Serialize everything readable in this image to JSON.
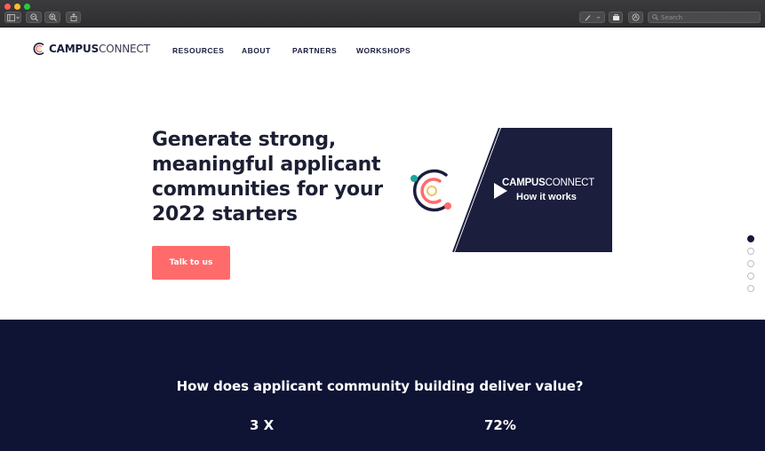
{
  "window": {
    "search_placeholder": "Search",
    "icons": [
      "sidebar-icon",
      "zoom-out-icon",
      "zoom-in-icon",
      "share-icon",
      "pen-icon",
      "markup-icon",
      "annotate-icon",
      "search-icon"
    ]
  },
  "logo": {
    "bold": "CAMPUS",
    "light": "CONNECT"
  },
  "nav": [
    {
      "label": "RESOURCES"
    },
    {
      "label": "ABOUT"
    },
    {
      "label": "PARTNERS"
    },
    {
      "label": "WORKSHOPS"
    }
  ],
  "hero": {
    "title_lines": [
      "Generate strong,",
      "meaningful applicant",
      "communities for your",
      "2022 starters"
    ],
    "cta_label": "Talk to us"
  },
  "video": {
    "brand_bold": "CAMPUS",
    "brand_light": "CONNECT",
    "subtitle": "How it works"
  },
  "pagination": {
    "count": 5,
    "active": 0
  },
  "value_section": {
    "title": "How does applicant community building deliver value?",
    "stats": [
      "3 X",
      "72%"
    ]
  },
  "colors": {
    "navy": "#0f1334",
    "coral": "#ff6b6b",
    "teal": "#1aa5a0",
    "gold": "#e8c66a"
  }
}
